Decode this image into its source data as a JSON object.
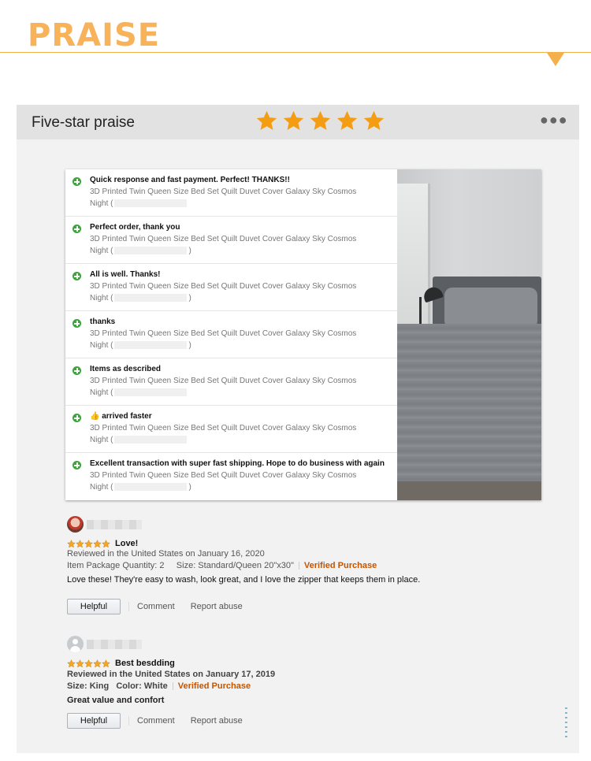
{
  "header": {
    "title": "PRAISE"
  },
  "panel": {
    "title": "Five-star praise",
    "star_count": 5,
    "star_color": "#f59d12",
    "more_icon": "more-dots-icon"
  },
  "feedback": {
    "items": [
      {
        "comment": "Quick response and fast payment. Perfect! THANKS!!",
        "product": "3D Printed Twin Queen Size Bed Set Quilt Duvet Cover Galaxy Sky Cosmos",
        "night": "Night"
      },
      {
        "comment": "Perfect order, thank you",
        "product": "3D Printed Twin Queen Size Bed Set Quilt Duvet Cover Galaxy Sky Cosmos",
        "night": "Night"
      },
      {
        "comment": "All is well. Thanks!",
        "product": "3D Printed Twin Queen Size Bed Set Quilt Duvet Cover Galaxy Sky Cosmos",
        "night": "Night"
      },
      {
        "comment": "thanks",
        "product": "3D Printed Twin Queen Size Bed Set Quilt Duvet Cover Galaxy Sky Cosmos",
        "night": "Night"
      },
      {
        "comment": "Items as described",
        "product": "3D Printed Twin Queen Size Bed Set Quilt Duvet Cover Galaxy Sky Cosmos",
        "night": "Night"
      },
      {
        "comment": "👍 arrived faster",
        "product": "3D Printed Twin Queen Size Bed Set Quilt Duvet Cover Galaxy Sky Cosmos",
        "night": "Night"
      },
      {
        "comment": "Excellent transaction with super fast shipping. Hope to do business with again",
        "product": "3D Printed Twin Queen Size Bed Set Quilt Duvet Cover Galaxy Sky Cosmos",
        "night": "Night"
      }
    ]
  },
  "reviews": [
    {
      "rating": 5,
      "heading": "Love!",
      "reviewed": "Reviewed in the United States on January 16, 2020",
      "quantity": "Item Package Quantity: 2",
      "size": "Size: Standard/Queen 20\"x30\"",
      "verified": "Verified Purchase",
      "body": "Love these! They're easy to wash, look great, and I love the zipper that keeps them in place.",
      "helpful": "Helpful",
      "comment": "Comment",
      "report": "Report abuse"
    },
    {
      "rating": 5,
      "heading": "Best besdding",
      "reviewed": "Reviewed in the United States on January 17, 2019",
      "size": "Size: King",
      "color": "Color: White",
      "verified": "Verified Purchase",
      "body": "Great value and confort",
      "helpful": "Helpful",
      "comment": "Comment",
      "report": "Report abuse"
    }
  ]
}
